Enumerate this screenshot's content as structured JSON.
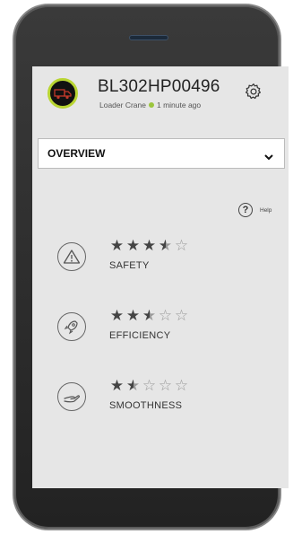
{
  "device": {
    "id": "BL302HP00496",
    "type": "Loader Crane",
    "status_color": "#9bc53d",
    "last_update": "1 minute ago",
    "avatar_accent": "#b9d532"
  },
  "view_select": {
    "selected": "OVERVIEW"
  },
  "help": {
    "label": "Help",
    "glyph": "?"
  },
  "metrics": [
    {
      "label": "SAFETY",
      "icon": "warning-triangle-icon",
      "rating": 3.5,
      "max": 5
    },
    {
      "label": "EFFICIENCY",
      "icon": "rocket-icon",
      "rating": 2.5,
      "max": 5
    },
    {
      "label": "SMOOTHNESS",
      "icon": "hand-icon",
      "rating": 1.5,
      "max": 5
    }
  ]
}
